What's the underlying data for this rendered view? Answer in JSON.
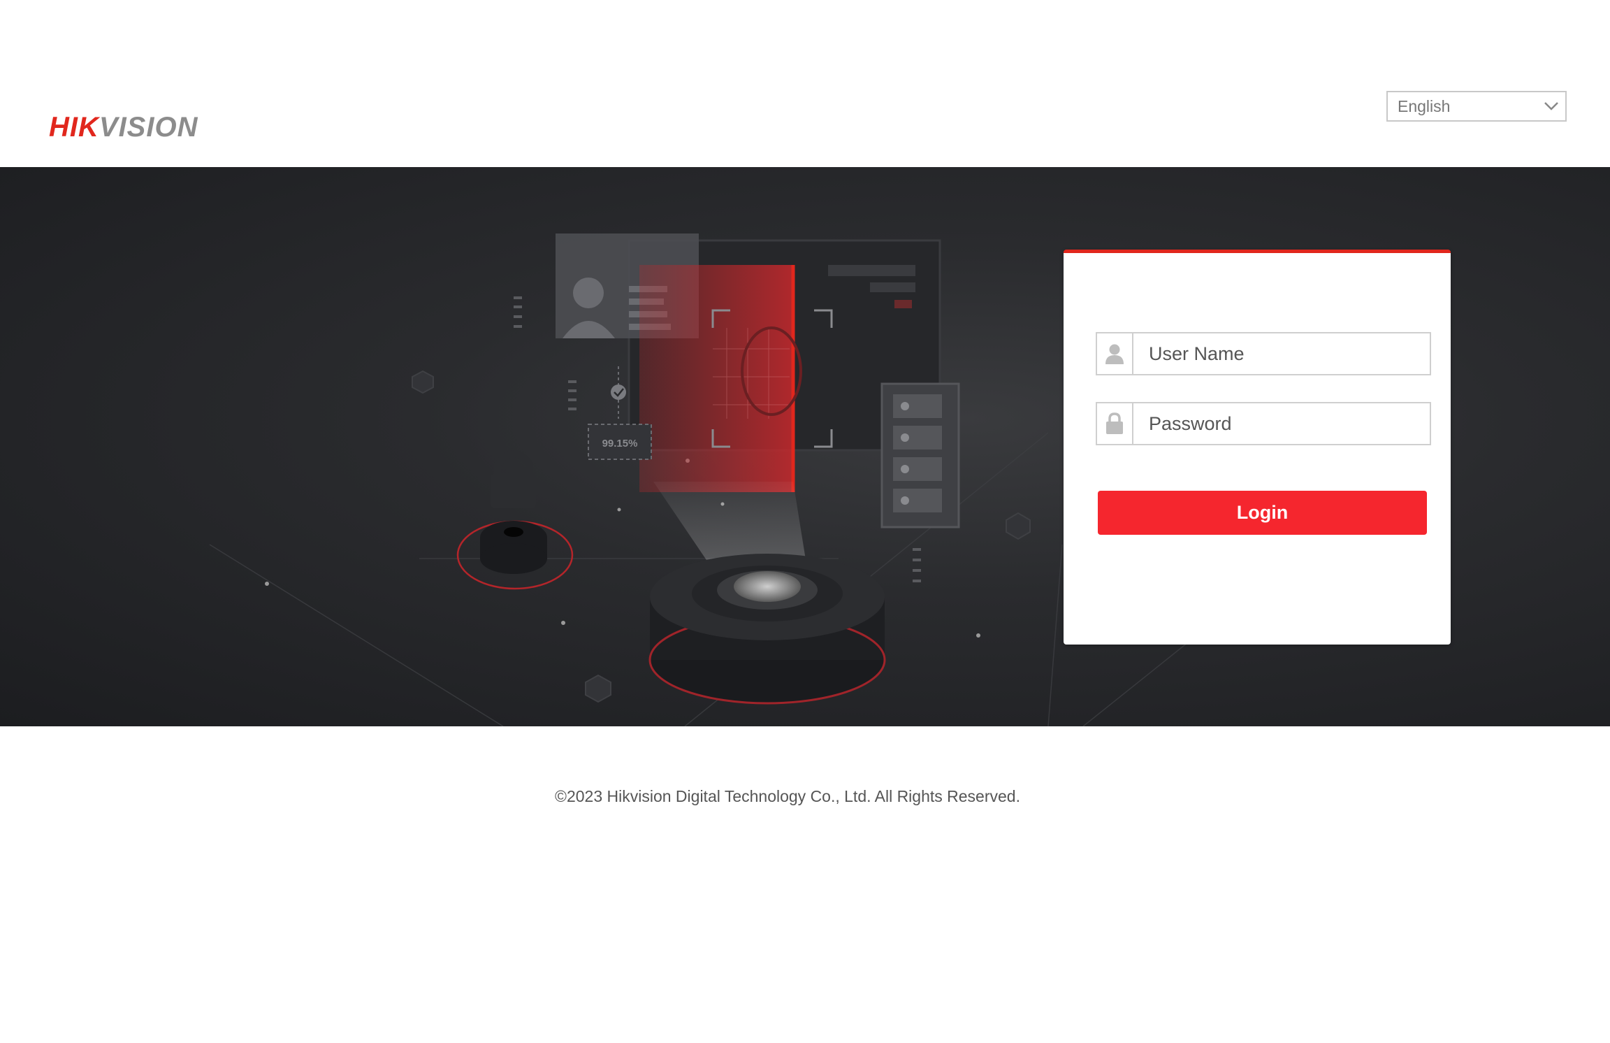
{
  "header": {
    "logo": {
      "part1": "HIK",
      "part2": "VISION"
    },
    "language": {
      "selected": "English",
      "icon": "chevron-down-icon"
    }
  },
  "banner": {
    "score_label": "99.15%"
  },
  "login": {
    "username_placeholder": "User Name",
    "password_placeholder": "Password",
    "username_icon": "user-icon",
    "password_icon": "lock-icon",
    "button_label": "Login"
  },
  "footer": {
    "copyright": "©2023 Hikvision Digital Technology Co., Ltd. All Rights Reserved."
  },
  "colors": {
    "brand_red": "#e1271d",
    "button_red": "#f5262e",
    "banner_dark": "#1c1d20",
    "logo_gray": "#8c8c8c"
  }
}
